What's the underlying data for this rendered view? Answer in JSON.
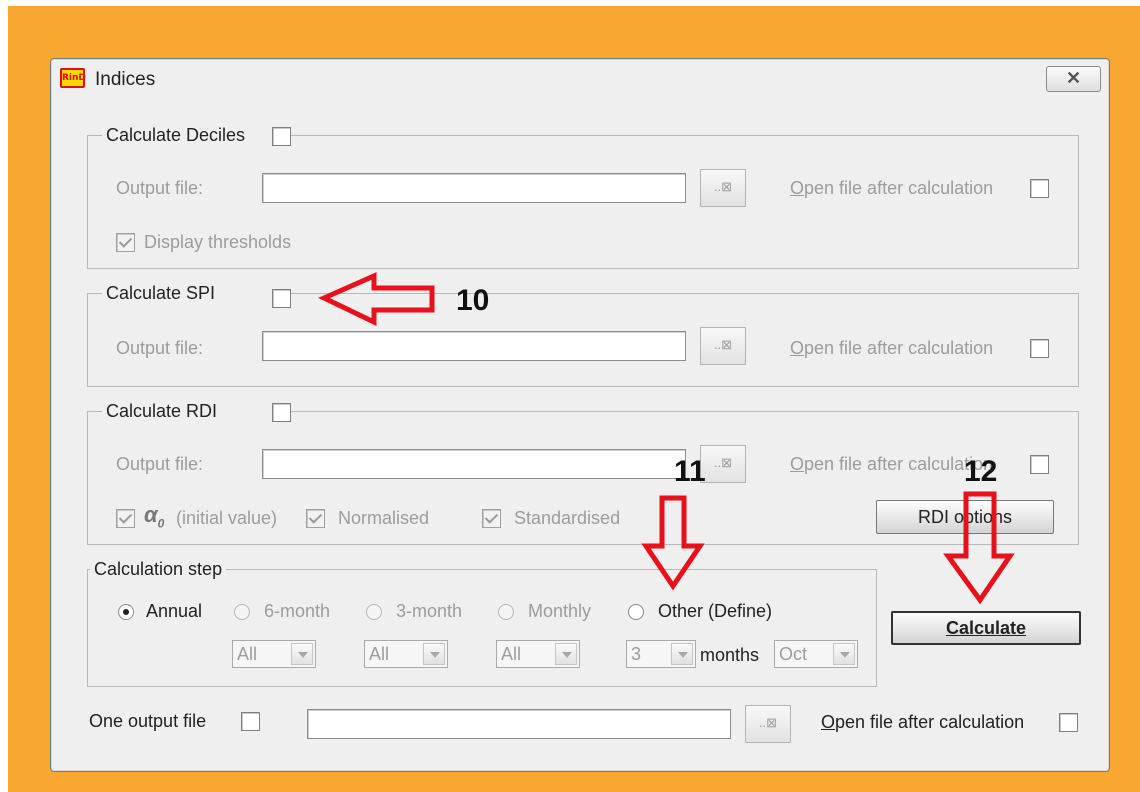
{
  "window": {
    "title": "Indices",
    "app_icon_text": "RinD",
    "close_glyph": "✕"
  },
  "deciles": {
    "legend": "Calculate Deciles",
    "output_label": "Output file:",
    "output_value": "",
    "browse_glyph": "..⊠",
    "open_after": "Open file after calculation",
    "display_thresholds": "Display thresholds"
  },
  "spi": {
    "legend": "Calculate SPI",
    "output_label": "Output file:",
    "output_value": "",
    "browse_glyph": "..⊠",
    "open_after": "Open file after calculation"
  },
  "rdi": {
    "legend": "Calculate RDI",
    "output_label": "Output file:",
    "output_value": "",
    "browse_glyph": "..⊠",
    "open_after": "Open file after calculation",
    "alpha_symbol": "α",
    "alpha_subscript": "0",
    "initial_value": "(initial value)",
    "normalised": "Normalised",
    "standardised": "Standardised",
    "options_button": "RDI options"
  },
  "calc_step": {
    "legend": "Calculation step",
    "annual": "Annual",
    "six_month": "6-month",
    "three_month": "3-month",
    "monthly": "Monthly",
    "other": "Other (Define)",
    "combo_six": "All",
    "combo_three": "All",
    "combo_monthly": "All",
    "combo_other_value": "3",
    "months_label": "months",
    "combo_month": "Oct"
  },
  "calculate_button": "Calculate",
  "bottom": {
    "one_output": "One output file",
    "output_value": "",
    "browse_glyph": "..⊠",
    "open_after": "Open file after calculation"
  },
  "annotations": {
    "n10": "10",
    "n11": "11",
    "n12": "12",
    "arrow_color": "#e8101a"
  }
}
